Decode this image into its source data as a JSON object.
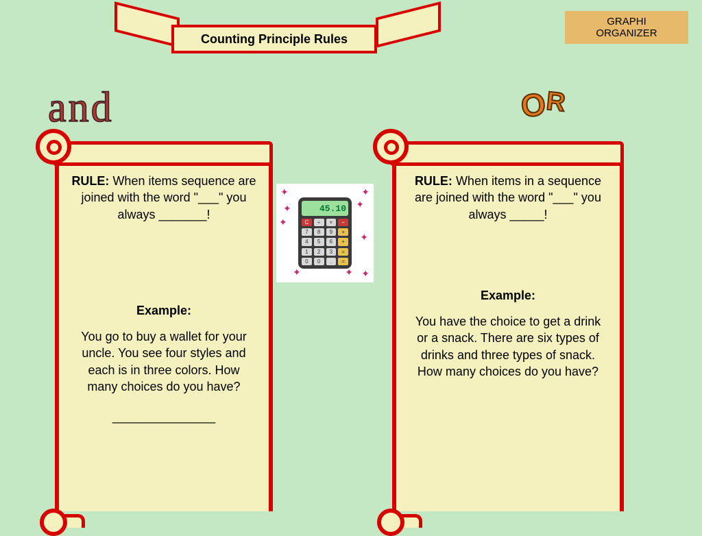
{
  "banner": {
    "title": "Counting Principle Rules"
  },
  "org_label": {
    "line1": "GRAPHI",
    "line2": "ORGANIZER"
  },
  "headings": {
    "and": "and",
    "or_c1": "O",
    "or_c2": "R"
  },
  "left": {
    "rule_label": "RULE:",
    "rule_text": "  When items sequence are joined with the word \"___\" you always _______!",
    "example_label": "Example:",
    "example_text": "You go to buy a wallet for your uncle. You see four styles and each is in three colors. How many choices do you have?",
    "answer_blank": "_______________"
  },
  "right": {
    "rule_label": "RULE:",
    "rule_text": "  When items in a sequence are joined with the word \"___\" you always _____!",
    "example_label": "Example:",
    "example_text": "You have the choice to get a drink or a snack. There are six types of drinks and three types of snack. How many choices do you have?"
  },
  "calc": {
    "display": "45.10"
  }
}
